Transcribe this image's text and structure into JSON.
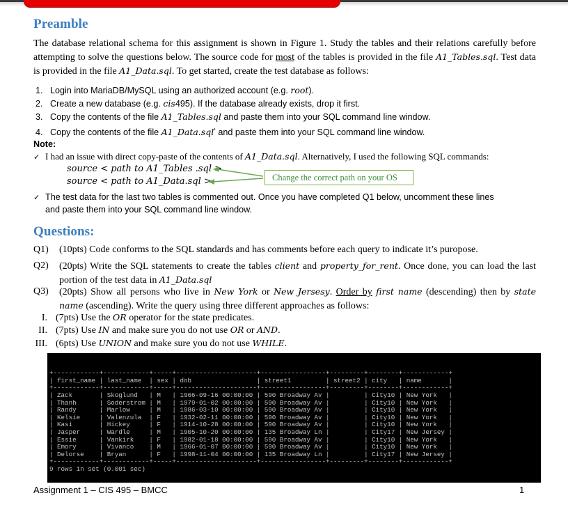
{
  "preamble": {
    "heading": "Preamble",
    "intro_parts": [
      {
        "t": "The database relational schema for this assignment is shown in Figure 1. Study the tables and their relations carefully before attempting to solve the questions below. The source code for "
      },
      {
        "t": "most",
        "u": true
      },
      {
        "t": " of the tables is provided in the file "
      },
      {
        "t": "A1_Tables.sql",
        "i": true
      },
      {
        "t": ". Test data is provided in the file "
      },
      {
        "t": "A1_Data.sql",
        "i": true
      },
      {
        "t": ". To get started, create the test database as follows:"
      }
    ],
    "steps": [
      {
        "num": "1.",
        "parts": [
          {
            "t": "Login into MariaDB/MySQL using an authorized account (e.g. "
          },
          {
            "t": "root",
            "i": true
          },
          {
            "t": ")."
          }
        ]
      },
      {
        "num": "2.",
        "parts": [
          {
            "t": "Create a new database (e.g. "
          },
          {
            "t": "cis",
            "i": true
          },
          {
            "t": "495). If the database already exists, drop it first."
          }
        ]
      },
      {
        "num": "3.",
        "parts": [
          {
            "t": "Copy the contents of the file "
          },
          {
            "t": "A1_Tables.sql",
            "i": true
          },
          {
            "t": " and paste them into your SQL command line window."
          }
        ]
      },
      {
        "num": "4.",
        "parts": [
          {
            "t": "Copy the contents of the file "
          },
          {
            "t": "A1_Data.sql",
            "i": true
          },
          {
            "t": "¹",
            "sup": true
          },
          {
            "t": " and paste them into your SQL command line window."
          }
        ]
      }
    ],
    "note_label": "Note:",
    "note1_parts": [
      {
        "t": "I had an issue with direct copy-paste of the contents of "
      },
      {
        "t": "A1_Data.sql",
        "i": true
      },
      {
        "t": ". Alternatively, I used the following SQL commands:"
      }
    ],
    "source_lines": [
      "source  < path to A1_Tables .sql >",
      "source  < path to A1_Data.sql >"
    ],
    "callout_text": "Change the correct path on your OS",
    "note2_line1": "The test data for the last two tables is commented out. Once you have completed Q1 below, uncomment these lines",
    "note2_line2": "and paste them into your SQL command line window.",
    "check_glyph": "✓"
  },
  "questions": {
    "heading": "Questions:",
    "items": [
      {
        "num": "Q1)",
        "parts": [
          {
            "t": "(10pts) Code conforms to the SQL standards and has comments before each query to indicate it’s puropose."
          }
        ]
      },
      {
        "num": "Q2)",
        "parts": [
          {
            "t": "(20pts) Write the SQL statements to create the tables "
          },
          {
            "t": "client",
            "i": true
          },
          {
            "t": " and "
          },
          {
            "t": "property_for_rent",
            "i": true
          },
          {
            "t": ". Once done, you can load the last portion of the test data in "
          },
          {
            "t": "A1_Data.sql",
            "i": true
          }
        ]
      },
      {
        "num": "Q3)",
        "parts": [
          {
            "t": "(20pts) Show all persons who live in "
          },
          {
            "t": "New York",
            "i": true
          },
          {
            "t": " or "
          },
          {
            "t": "New Jersesy",
            "i": true
          },
          {
            "t": ". "
          },
          {
            "t": "Order by",
            "u": true
          },
          {
            "t": " "
          },
          {
            "t": "first name",
            "i": true
          },
          {
            "t": " (descending) then by "
          },
          {
            "t": "state name",
            "i": true
          },
          {
            "t": " (ascending). Write the query using three different approaches as follows:"
          }
        ]
      }
    ],
    "sub_items": [
      {
        "num": "I.",
        "parts": [
          {
            "t": "(7pts) Use the "
          },
          {
            "t": "OR",
            "i": true
          },
          {
            "t": " operator for the state predicates."
          }
        ]
      },
      {
        "num": "II.",
        "parts": [
          {
            "t": "(7pts) Use "
          },
          {
            "t": "IN",
            "i": true
          },
          {
            "t": " and make sure you do not use "
          },
          {
            "t": "OR",
            "i": true
          },
          {
            "t": " or "
          },
          {
            "t": "AND",
            "i": true
          },
          {
            "t": "."
          }
        ]
      },
      {
        "num": "III.",
        "parts": [
          {
            "t": "(6pts) Use "
          },
          {
            "t": "UNION",
            "i": true
          },
          {
            "t": " and make sure you do not use "
          },
          {
            "t": "WHILE",
            "i": true
          },
          {
            "t": "."
          }
        ]
      }
    ]
  },
  "terminal": {
    "columns": [
      "first_name",
      "last_name",
      "sex",
      "dob",
      "street1",
      "street2",
      "city",
      "name"
    ],
    "rows": [
      [
        "Zack",
        "Skoglund",
        "M",
        "1966-09-16 00:00:00",
        "590 Broadway Av",
        "",
        "City10",
        "New York"
      ],
      [
        "Thanh",
        "Soderstrom",
        "M",
        "1979-01-02 00:00:00",
        "590 Broadway Av",
        "",
        "City10",
        "New York"
      ],
      [
        "Randy",
        "Marlow",
        "M",
        "1986-03-10 00:00:00",
        "590 Broadway Av",
        "",
        "City10",
        "New York"
      ],
      [
        "Kelsie",
        "Valenzula",
        "F",
        "1932-02-11 00:00:00",
        "590 Broadway Av",
        "",
        "City10",
        "New York"
      ],
      [
        "Kasi",
        "Hickey",
        "F",
        "1914-10-28 00:00:00",
        "590 Broadway Av",
        "",
        "City10",
        "New York"
      ],
      [
        "Jasper",
        "Wardle",
        "M",
        "1905-10-20 00:00:00",
        "135 Broadway Ln",
        "",
        "City17",
        "New Jersey"
      ],
      [
        "Essie",
        "Vankirk",
        "F",
        "1982-01-18 00:00:00",
        "590 Broadway Av",
        "",
        "City10",
        "New York"
      ],
      [
        "Emory",
        "Vivanco",
        "M",
        "1966-01-07 00:00:00",
        "590 Broadway Av",
        "",
        "City10",
        "New York"
      ],
      [
        "Delorse",
        "Bryan",
        "F",
        "1998-11-04 00:00:00",
        "135 Broadway Ln",
        "",
        "City17",
        "New Jersey"
      ]
    ],
    "status": "9 rows in set (0.001 sec)"
  },
  "footer": {
    "left": "Assignment 1 – CIS 495 – BMCC",
    "page_number": "1"
  },
  "colors": {
    "heading": "#3d7fbf",
    "banner_red": "#e60000",
    "callout_green": "#7cb342"
  }
}
